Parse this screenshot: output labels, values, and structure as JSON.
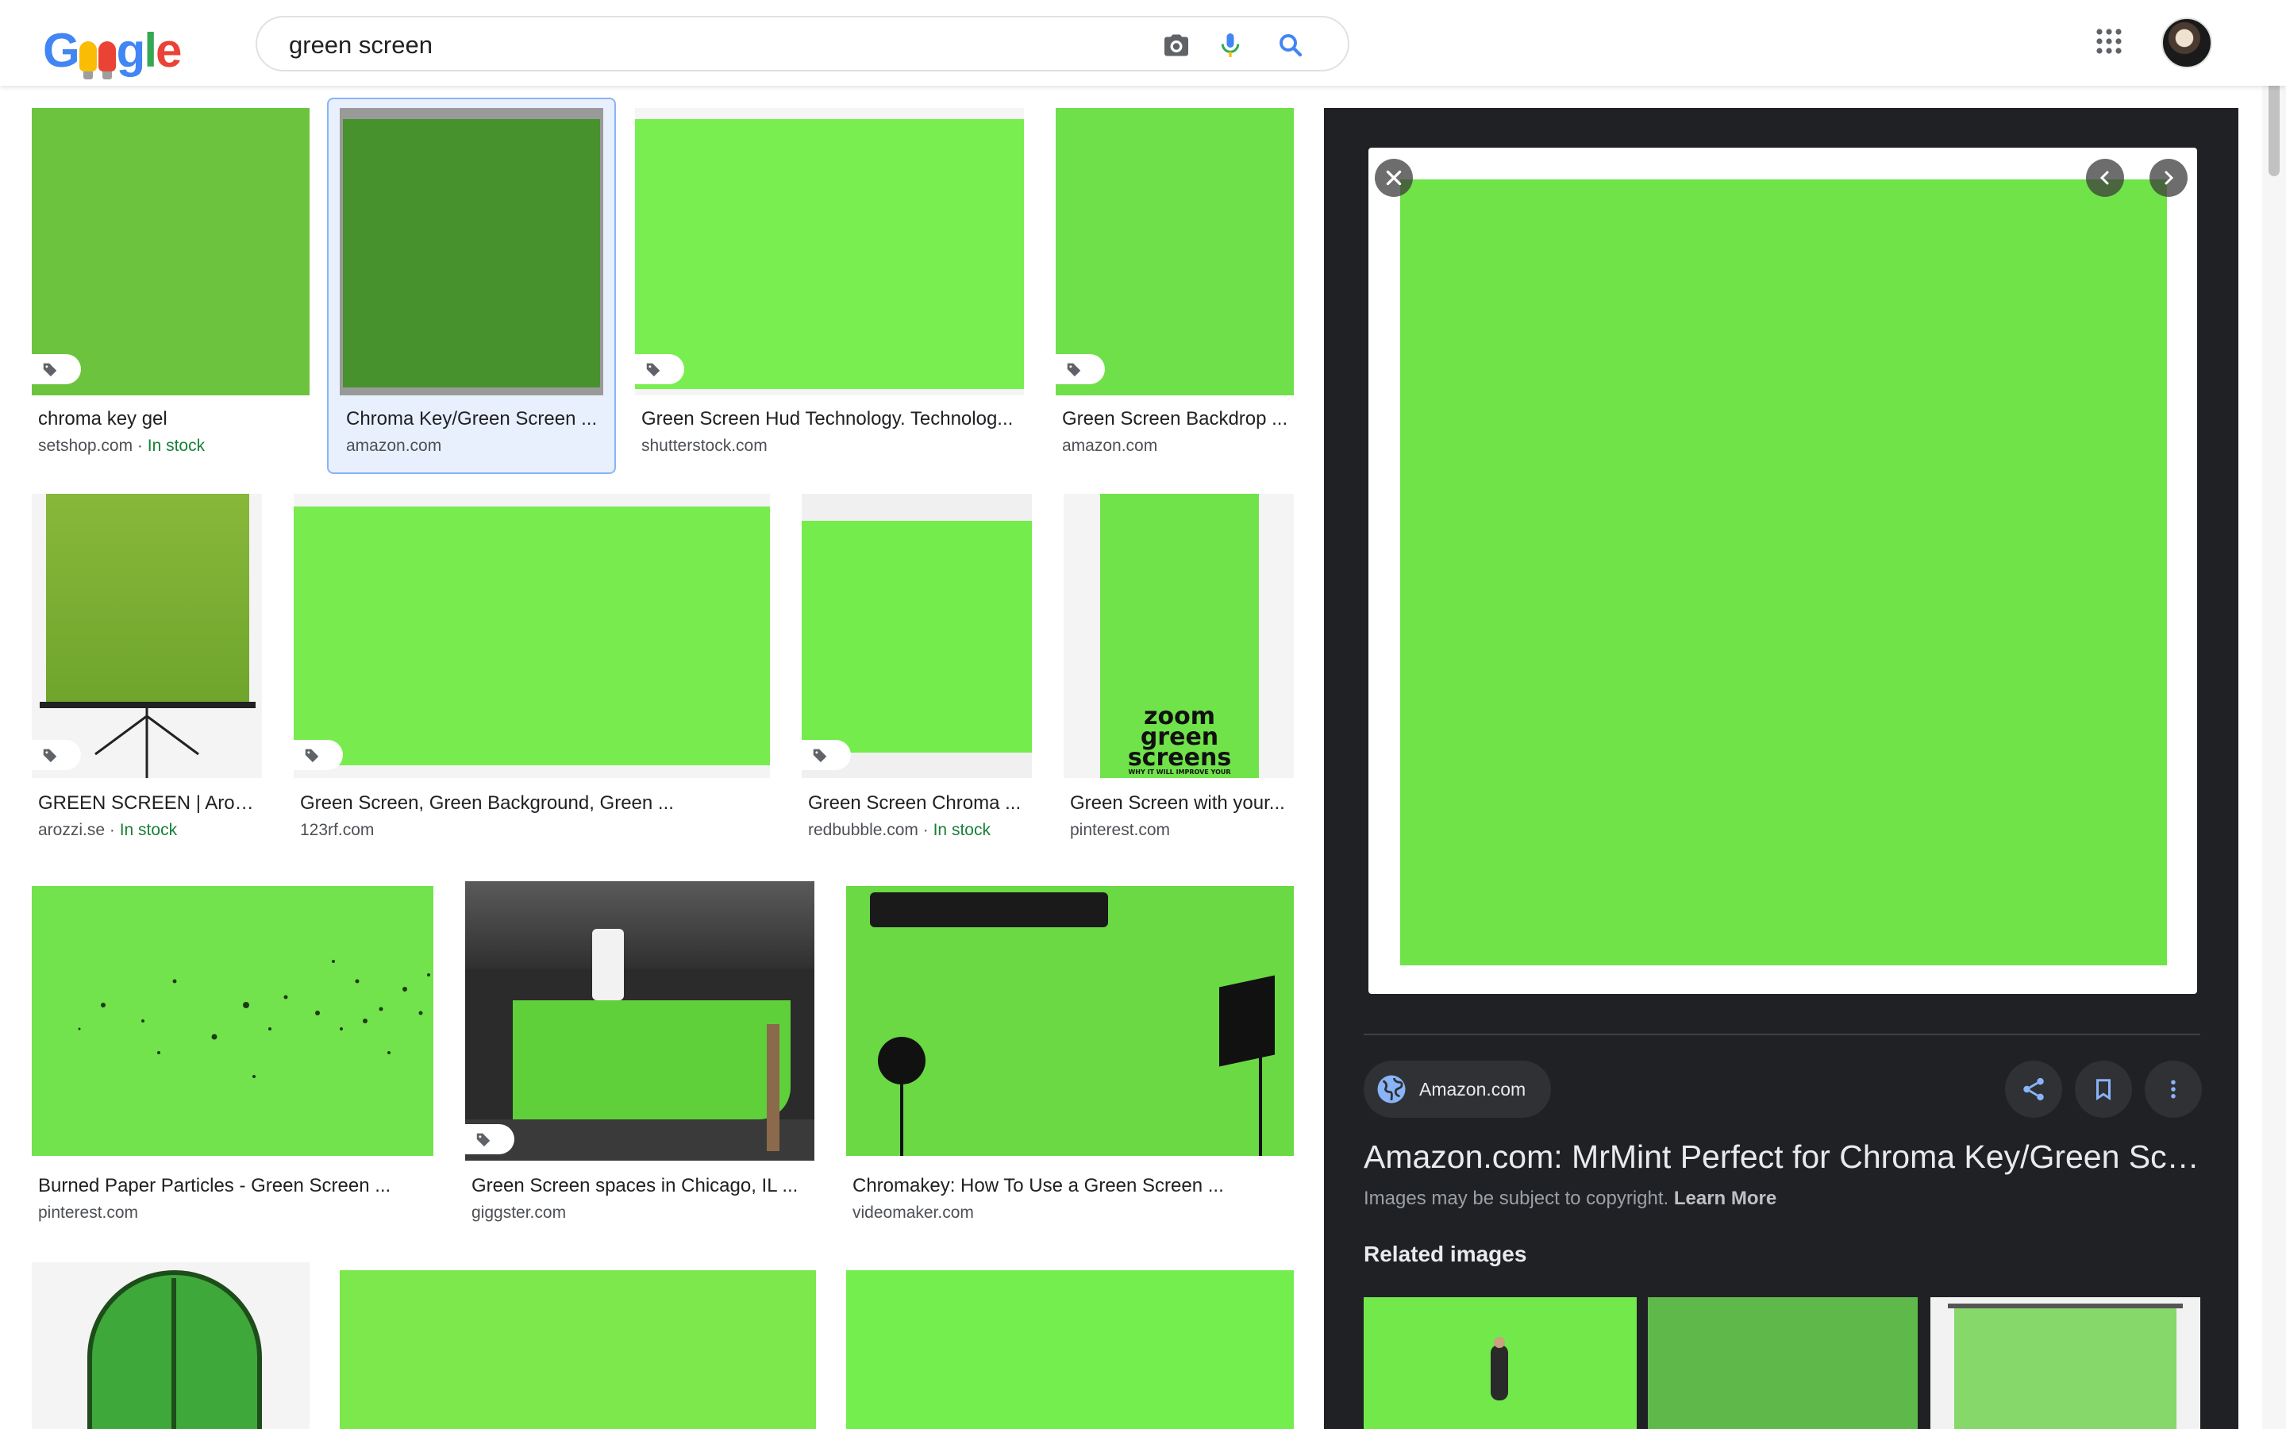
{
  "header": {
    "logo": "Google",
    "search_query": "green screen"
  },
  "results": [
    {
      "caption": "chroma key gel",
      "source": "setshop.com",
      "stock": "In stock"
    },
    {
      "caption": "Chroma Key/Green Screen ...",
      "source": "amazon.com",
      "selected": true
    },
    {
      "caption": "Green Screen Hud Technology. Technolog...",
      "source": "shutterstock.com"
    },
    {
      "caption": "Green Screen Backdrop ...",
      "source": "amazon.com"
    },
    {
      "caption": "GREEN SCREEN | Arozz...",
      "source": "arozzi.se",
      "stock": "In stock"
    },
    {
      "caption": "Green Screen, Green Background, Green ...",
      "source": "123rf.com"
    },
    {
      "caption": "Green Screen Chroma ...",
      "source": "redbubble.com",
      "stock": "In stock"
    },
    {
      "caption": "Green Screen with your...",
      "source": "pinterest.com"
    },
    {
      "caption": "Burned Paper Particles - Green Screen ...",
      "source": "pinterest.com"
    },
    {
      "caption": "Green Screen spaces in Chicago, IL ...",
      "source": "giggster.com"
    },
    {
      "caption": "Chromakey: How To Use a Green Screen ...",
      "source": "videomaker.com"
    }
  ],
  "poster_text": {
    "line1": "zoom",
    "line2": "green",
    "line3": "screens",
    "small": "WHY IT WILL IMPROVE YOUR"
  },
  "preview": {
    "source_chip": "Amazon.com",
    "title": "Amazon.com: MrMint Perfect for Chroma Key/Green Scre...",
    "note": "Images may be subject to copyright.",
    "learn_more": "Learn More",
    "related_heading": "Related images"
  },
  "colors": {
    "accent_blue": "#1a73e8",
    "stock_green": "#188038",
    "panel_bg": "#202124"
  },
  "icons": [
    "camera-icon",
    "mic-icon",
    "search-icon",
    "apps-grid-icon",
    "tag-icon",
    "close-icon",
    "chevron-left-icon",
    "chevron-right-icon",
    "globe-icon",
    "share-icon",
    "bookmark-icon",
    "more-vert-icon"
  ]
}
